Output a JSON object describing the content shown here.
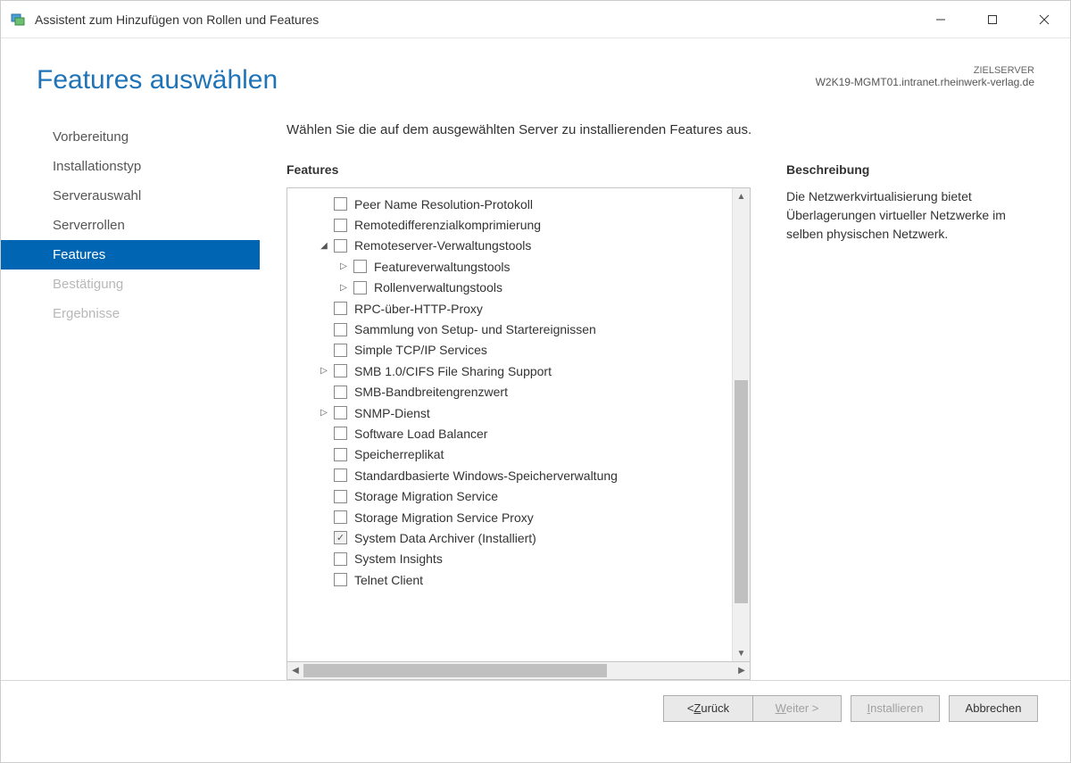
{
  "window": {
    "title": "Assistent zum Hinzufügen von Rollen und Features"
  },
  "header": {
    "title": "Features auswählen",
    "target_label": "ZIELSERVER",
    "target_value": "W2K19-MGMT01.intranet.rheinwerk-verlag.de"
  },
  "sidebar": {
    "steps": [
      {
        "label": "Vorbereitung",
        "state": "done"
      },
      {
        "label": "Installationstyp",
        "state": "done"
      },
      {
        "label": "Serverauswahl",
        "state": "done"
      },
      {
        "label": "Serverrollen",
        "state": "done"
      },
      {
        "label": "Features",
        "state": "active"
      },
      {
        "label": "Bestätigung",
        "state": "disabled"
      },
      {
        "label": "Ergebnisse",
        "state": "disabled"
      }
    ]
  },
  "main": {
    "instruction": "Wählen Sie die auf dem ausgewählten Server zu installierenden Features aus.",
    "features_label": "Features",
    "desc_label": "Beschreibung",
    "desc_text": "Die Netzwerkvirtualisierung bietet Überlagerungen virtueller Netzwerke im selben physischen Netzwerk."
  },
  "features": [
    {
      "label": "Peer Name Resolution-Protokoll",
      "indent": 1,
      "expander": "none",
      "checked": false
    },
    {
      "label": "Remotedifferenzialkomprimierung",
      "indent": 1,
      "expander": "none",
      "checked": false
    },
    {
      "label": "Remoteserver-Verwaltungstools",
      "indent": 1,
      "expander": "open",
      "checked": false
    },
    {
      "label": "Featureverwaltungstools",
      "indent": 2,
      "expander": "closed",
      "checked": false
    },
    {
      "label": "Rollenverwaltungstools",
      "indent": 2,
      "expander": "closed",
      "checked": false
    },
    {
      "label": "RPC-über-HTTP-Proxy",
      "indent": 1,
      "expander": "none",
      "checked": false
    },
    {
      "label": "Sammlung von Setup- und Startereignissen",
      "indent": 1,
      "expander": "none",
      "checked": false
    },
    {
      "label": "Simple TCP/IP Services",
      "indent": 1,
      "expander": "none",
      "checked": false
    },
    {
      "label": "SMB 1.0/CIFS File Sharing Support",
      "indent": 1,
      "expander": "closed",
      "checked": false
    },
    {
      "label": "SMB-Bandbreitengrenzwert",
      "indent": 1,
      "expander": "none",
      "checked": false
    },
    {
      "label": "SNMP-Dienst",
      "indent": 1,
      "expander": "closed",
      "checked": false
    },
    {
      "label": "Software Load Balancer",
      "indent": 1,
      "expander": "none",
      "checked": false
    },
    {
      "label": "Speicherreplikat",
      "indent": 1,
      "expander": "none",
      "checked": false
    },
    {
      "label": "Standardbasierte Windows-Speicherverwaltung",
      "indent": 1,
      "expander": "none",
      "checked": false
    },
    {
      "label": "Storage Migration Service",
      "indent": 1,
      "expander": "none",
      "checked": false
    },
    {
      "label": "Storage Migration Service Proxy",
      "indent": 1,
      "expander": "none",
      "checked": false
    },
    {
      "label": "System Data Archiver (Installiert)",
      "indent": 1,
      "expander": "none",
      "checked": true
    },
    {
      "label": "System Insights",
      "indent": 1,
      "expander": "none",
      "checked": false
    },
    {
      "label": "Telnet Client",
      "indent": 1,
      "expander": "none",
      "checked": false
    }
  ],
  "footer": {
    "back": "< Zurück",
    "next": "Weiter >",
    "install": "Installieren",
    "cancel": "Abbrechen"
  }
}
